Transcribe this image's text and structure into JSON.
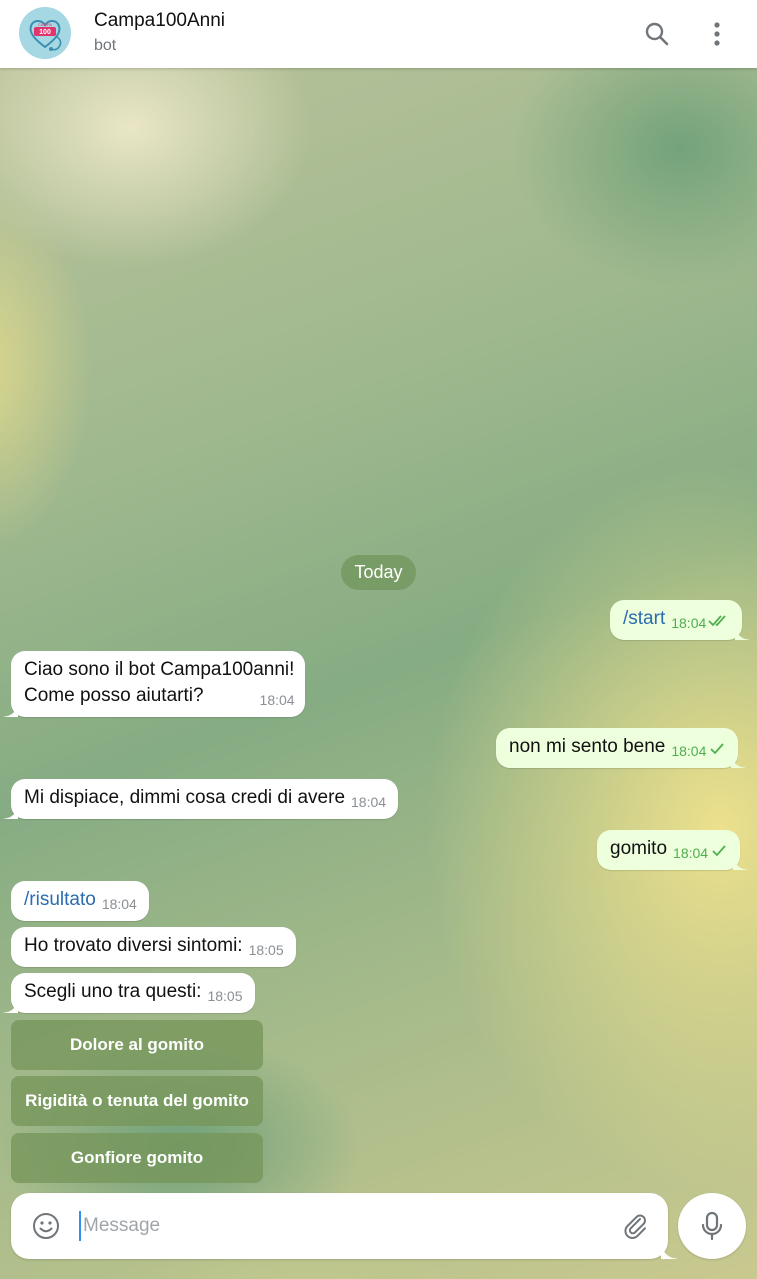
{
  "header": {
    "title": "Campa100Anni",
    "subtitle": "bot",
    "avatar_text": "CAMPA 100 ANNI"
  },
  "date_divider": "Today",
  "messages": [
    {
      "dir": "out",
      "text": "/start",
      "time": "18:04",
      "status": "read"
    },
    {
      "dir": "in",
      "line1": "Ciao sono il bot Campa100anni!",
      "line2": "Come posso aiutarti?",
      "time": "18:04"
    },
    {
      "dir": "out",
      "text": "non mi sento bene",
      "time": "18:04",
      "status": "sent"
    },
    {
      "dir": "in",
      "text": "Mi dispiace, dimmi cosa credi di avere",
      "time": "18:04"
    },
    {
      "dir": "out",
      "text": "gomito",
      "time": "18:04",
      "status": "sent"
    },
    {
      "dir": "in",
      "text": "/risultato",
      "time": "18:04"
    },
    {
      "dir": "in",
      "text": "Ho trovato diversi sintomi:",
      "time": "18:05"
    },
    {
      "dir": "in",
      "text": "Scegli uno tra questi:",
      "time": "18:05"
    }
  ],
  "keyboard": [
    "Dolore al gomito",
    "Rigidità o tenuta del gomito",
    "Gonfiore gomito"
  ],
  "composer": {
    "placeholder": "Message"
  },
  "icons": {
    "search": "search-icon",
    "more": "more-vertical-icon",
    "emoji": "emoji-icon",
    "attach": "paperclip-icon",
    "mic": "microphone-icon"
  },
  "colors": {
    "outgoing_bubble": "#eeffde",
    "incoming_bubble": "#ffffff",
    "check": "#4fae4e",
    "accent": "#3390ec"
  }
}
